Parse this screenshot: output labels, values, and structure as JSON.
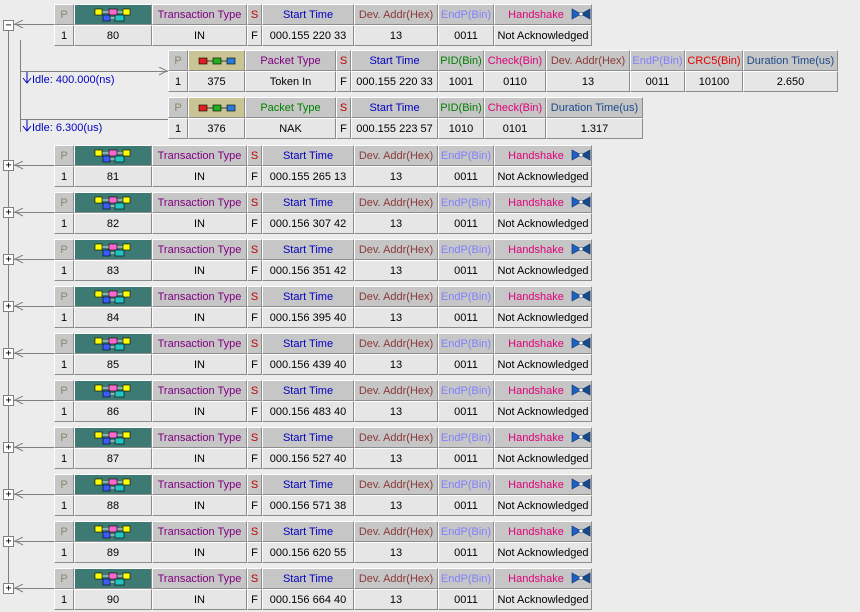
{
  "colors": {
    "p": "#8a8a6a",
    "trans_type": "#800080",
    "s": "#c00000",
    "start_time": "#0000c0",
    "dev_addr": "#8b3a3a",
    "endp": "#8080ff",
    "handshake": "#e0007a",
    "pid": "#008000",
    "check": "#e0007a",
    "crc5": "#e00000",
    "duration": "#1a4a8a",
    "packet_type": "#800080",
    "packet_type_nak": "#008000"
  },
  "headers": {
    "p": "P",
    "trans_type": "Transaction Type",
    "s": "S",
    "start_time": "Start Time",
    "dev_addr": "Dev. Addr(Hex)",
    "endp": "EndP(Bin)",
    "handshake": "Handshake",
    "packet_type": "Packet Type",
    "pid": "PID(Bin)",
    "check": "Check(Bin)",
    "crc5": "CRC5(Bin)",
    "duration": "Duration Time(us)"
  },
  "idle": [
    "Idle: 400.000(ns)",
    "Idle: 6.300(us)"
  ],
  "packets": [
    {
      "p": "1",
      "num": "375",
      "type": "Token In",
      "s": "F",
      "start": "000.155 220 33",
      "pid": "1001",
      "check": "0110",
      "dev": "13",
      "endp": "0011",
      "crc5": "10100",
      "dur": "2.650"
    },
    {
      "p": "1",
      "num": "376",
      "type": "NAK",
      "s": "F",
      "start": "000.155 223 57",
      "pid": "1010",
      "check": "0101",
      "dur": "1.317"
    }
  ],
  "transactions": [
    {
      "p": "1",
      "num": "80",
      "type": "IN",
      "s": "F",
      "start": "000.155 220 33",
      "dev": "13",
      "endp": "0011",
      "hs": "Not Acknowledged",
      "toggle": "−"
    },
    {
      "p": "1",
      "num": "81",
      "type": "IN",
      "s": "F",
      "start": "000.155 265 13",
      "dev": "13",
      "endp": "0011",
      "hs": "Not Acknowledged",
      "toggle": "+"
    },
    {
      "p": "1",
      "num": "82",
      "type": "IN",
      "s": "F",
      "start": "000.156 307 42",
      "dev": "13",
      "endp": "0011",
      "hs": "Not Acknowledged",
      "toggle": "+"
    },
    {
      "p": "1",
      "num": "83",
      "type": "IN",
      "s": "F",
      "start": "000.156 351 42",
      "dev": "13",
      "endp": "0011",
      "hs": "Not Acknowledged",
      "toggle": "+"
    },
    {
      "p": "1",
      "num": "84",
      "type": "IN",
      "s": "F",
      "start": "000.156 395 40",
      "dev": "13",
      "endp": "0011",
      "hs": "Not Acknowledged",
      "toggle": "+"
    },
    {
      "p": "1",
      "num": "85",
      "type": "IN",
      "s": "F",
      "start": "000.156 439 40",
      "dev": "13",
      "endp": "0011",
      "hs": "Not Acknowledged",
      "toggle": "+"
    },
    {
      "p": "1",
      "num": "86",
      "type": "IN",
      "s": "F",
      "start": "000.156 483 40",
      "dev": "13",
      "endp": "0011",
      "hs": "Not Acknowledged",
      "toggle": "+"
    },
    {
      "p": "1",
      "num": "87",
      "type": "IN",
      "s": "F",
      "start": "000.156 527 40",
      "dev": "13",
      "endp": "0011",
      "hs": "Not Acknowledged",
      "toggle": "+"
    },
    {
      "p": "1",
      "num": "88",
      "type": "IN",
      "s": "F",
      "start": "000.156 571 38",
      "dev": "13",
      "endp": "0011",
      "hs": "Not Acknowledged",
      "toggle": "+"
    },
    {
      "p": "1",
      "num": "89",
      "type": "IN",
      "s": "F",
      "start": "000.156 620 55",
      "dev": "13",
      "endp": "0011",
      "hs": "Not Acknowledged",
      "toggle": "+"
    },
    {
      "p": "1",
      "num": "90",
      "type": "IN",
      "s": "F",
      "start": "000.156 664 40",
      "dev": "13",
      "endp": "0011",
      "hs": "Not Acknowledged",
      "toggle": "+"
    }
  ]
}
